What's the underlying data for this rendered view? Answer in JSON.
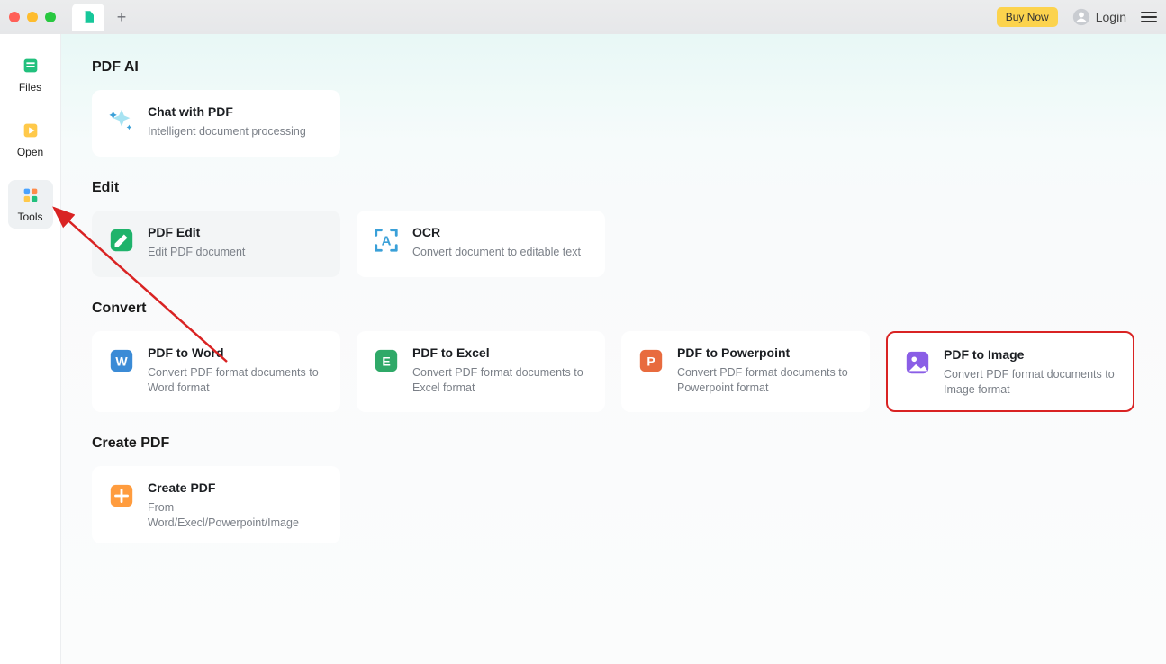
{
  "titlebar": {
    "buy_now_label": "Buy Now",
    "login_label": "Login"
  },
  "nav": {
    "files": "Files",
    "open": "Open",
    "tools": "Tools"
  },
  "sections": {
    "pdf_ai": {
      "title": "PDF AI"
    },
    "edit": {
      "title": "Edit"
    },
    "convert": {
      "title": "Convert"
    },
    "create": {
      "title": "Create PDF"
    }
  },
  "cards": {
    "chat": {
      "title": "Chat with PDF",
      "desc": "Intelligent document processing"
    },
    "pdf_edit": {
      "title": "PDF Edit",
      "desc": "Edit PDF document"
    },
    "ocr": {
      "title": "OCR",
      "desc": "Convert document to editable text"
    },
    "to_word": {
      "title": "PDF to Word",
      "desc": "Convert PDF format documents to Word format"
    },
    "to_excel": {
      "title": "PDF to Excel",
      "desc": "Convert PDF format documents to Excel format"
    },
    "to_ppt": {
      "title": "PDF to Powerpoint",
      "desc": "Convert PDF format documents to Powerpoint format"
    },
    "to_img": {
      "title": "PDF to Image",
      "desc": "Convert PDF format documents to Image format"
    },
    "create": {
      "title": "Create PDF",
      "desc": "From Word/Execl/Powerpoint/Image"
    }
  }
}
